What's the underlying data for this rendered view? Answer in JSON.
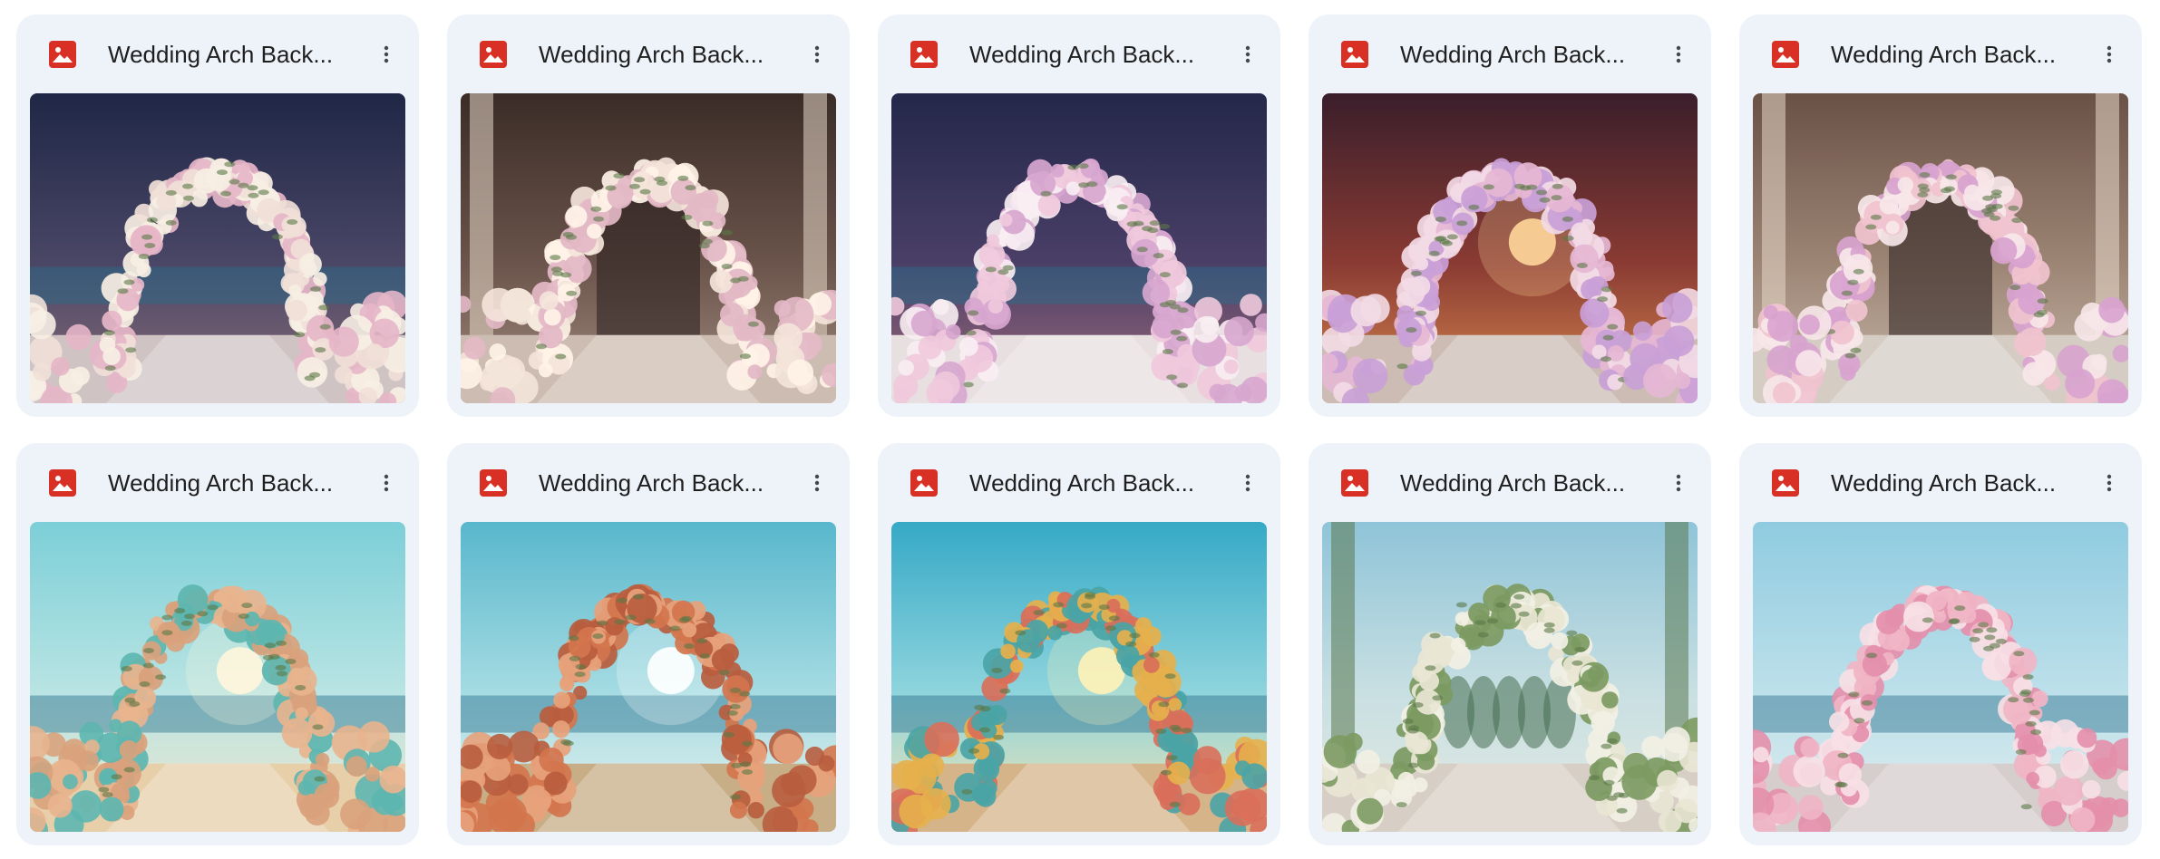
{
  "files": [
    {
      "name": "Wedding Arch Back...",
      "icon": "image-file-icon",
      "thumb": {
        "scene": "night",
        "sky": [
          "#1f2746",
          "#4a4666",
          "#8a6d78"
        ],
        "ground": "#cfc3c4",
        "floral": [
          "#f1e0d8",
          "#e6b6c8",
          "#f7efe4"
        ],
        "sun": "none"
      }
    },
    {
      "name": "Wedding Arch Back...",
      "icon": "image-file-icon",
      "thumb": {
        "scene": "hall",
        "sky": [
          "#3b2c27",
          "#6a544b",
          "#a38d80"
        ],
        "ground": "#cdbcb1",
        "floral": [
          "#f4e4da",
          "#e3b9c6",
          "#fff3e8"
        ],
        "sun": "none"
      }
    },
    {
      "name": "Wedding Arch Back...",
      "icon": "image-file-icon",
      "thumb": {
        "scene": "night",
        "sky": [
          "#23274a",
          "#4a3f67",
          "#a06a7a"
        ],
        "ground": "#e8dfe1",
        "floral": [
          "#f0c9dc",
          "#d7a6cf",
          "#f8eef2"
        ],
        "sun": "none"
      }
    },
    {
      "name": "Wedding Arch Back...",
      "icon": "image-file-icon",
      "thumb": {
        "scene": "sunset",
        "sky": [
          "#3a1e2b",
          "#8a3b33",
          "#d98a4f"
        ],
        "ground": "#cdbcb4",
        "floral": [
          "#e6b7d4",
          "#c9a0d7",
          "#f3dbe6"
        ],
        "sun": "#ffd79a"
      }
    },
    {
      "name": "Wedding Arch Back...",
      "icon": "image-file-icon",
      "thumb": {
        "scene": "hall",
        "sky": [
          "#6a5146",
          "#9d8575",
          "#c7b8aa"
        ],
        "ground": "#d5ccc4",
        "floral": [
          "#f0c3cf",
          "#d8a3cf",
          "#f7e7e9"
        ],
        "sun": "none"
      }
    },
    {
      "name": "Wedding Arch Back...",
      "icon": "image-file-icon",
      "thumb": {
        "scene": "beach",
        "sky": [
          "#7ccfd8",
          "#b9e4e3",
          "#f0e6cc"
        ],
        "ground": "#e7cfaa",
        "floral": [
          "#d9a27c",
          "#e8b48e",
          "#5db6b0"
        ],
        "sun": "#fff6dc"
      }
    },
    {
      "name": "Wedding Arch Back...",
      "icon": "image-file-icon",
      "thumb": {
        "scene": "beach",
        "sky": [
          "#58b7cc",
          "#a5dbe2",
          "#e9f2ee"
        ],
        "ground": "#c7ae86",
        "floral": [
          "#d3754d",
          "#e7a27b",
          "#b85d3e"
        ],
        "sun": "#ffffff"
      }
    },
    {
      "name": "Wedding Arch Back...",
      "icon": "image-file-icon",
      "thumb": {
        "scene": "beach",
        "sky": [
          "#36a9c6",
          "#8ed4dd",
          "#f5e3b0"
        ],
        "ground": "#d6b48a",
        "floral": [
          "#e6b04c",
          "#d96f5a",
          "#4aa4a6"
        ],
        "sun": "#fff2b8"
      }
    },
    {
      "name": "Wedding Arch Back...",
      "icon": "image-file-icon",
      "thumb": {
        "scene": "garden",
        "sky": [
          "#8fc4d8",
          "#c8dfe2",
          "#e4eae3"
        ],
        "ground": "#d7cfc5",
        "floral": [
          "#f2f0e4",
          "#7c9a62",
          "#e9e6d4"
        ],
        "sun": "none"
      }
    },
    {
      "name": "Wedding Arch Back...",
      "icon": "image-file-icon",
      "thumb": {
        "scene": "terrace",
        "sky": [
          "#8fcbe0",
          "#bde0ea",
          "#dfecee"
        ],
        "ground": "#d6cdcd",
        "floral": [
          "#f0b5c6",
          "#e48fab",
          "#f7e0e6"
        ],
        "sun": "none"
      }
    }
  ],
  "colors": {
    "card_bg": "#eef2f9",
    "icon_red": "#d93025",
    "text": "#1f1f1f",
    "more_icon": "#444746"
  }
}
